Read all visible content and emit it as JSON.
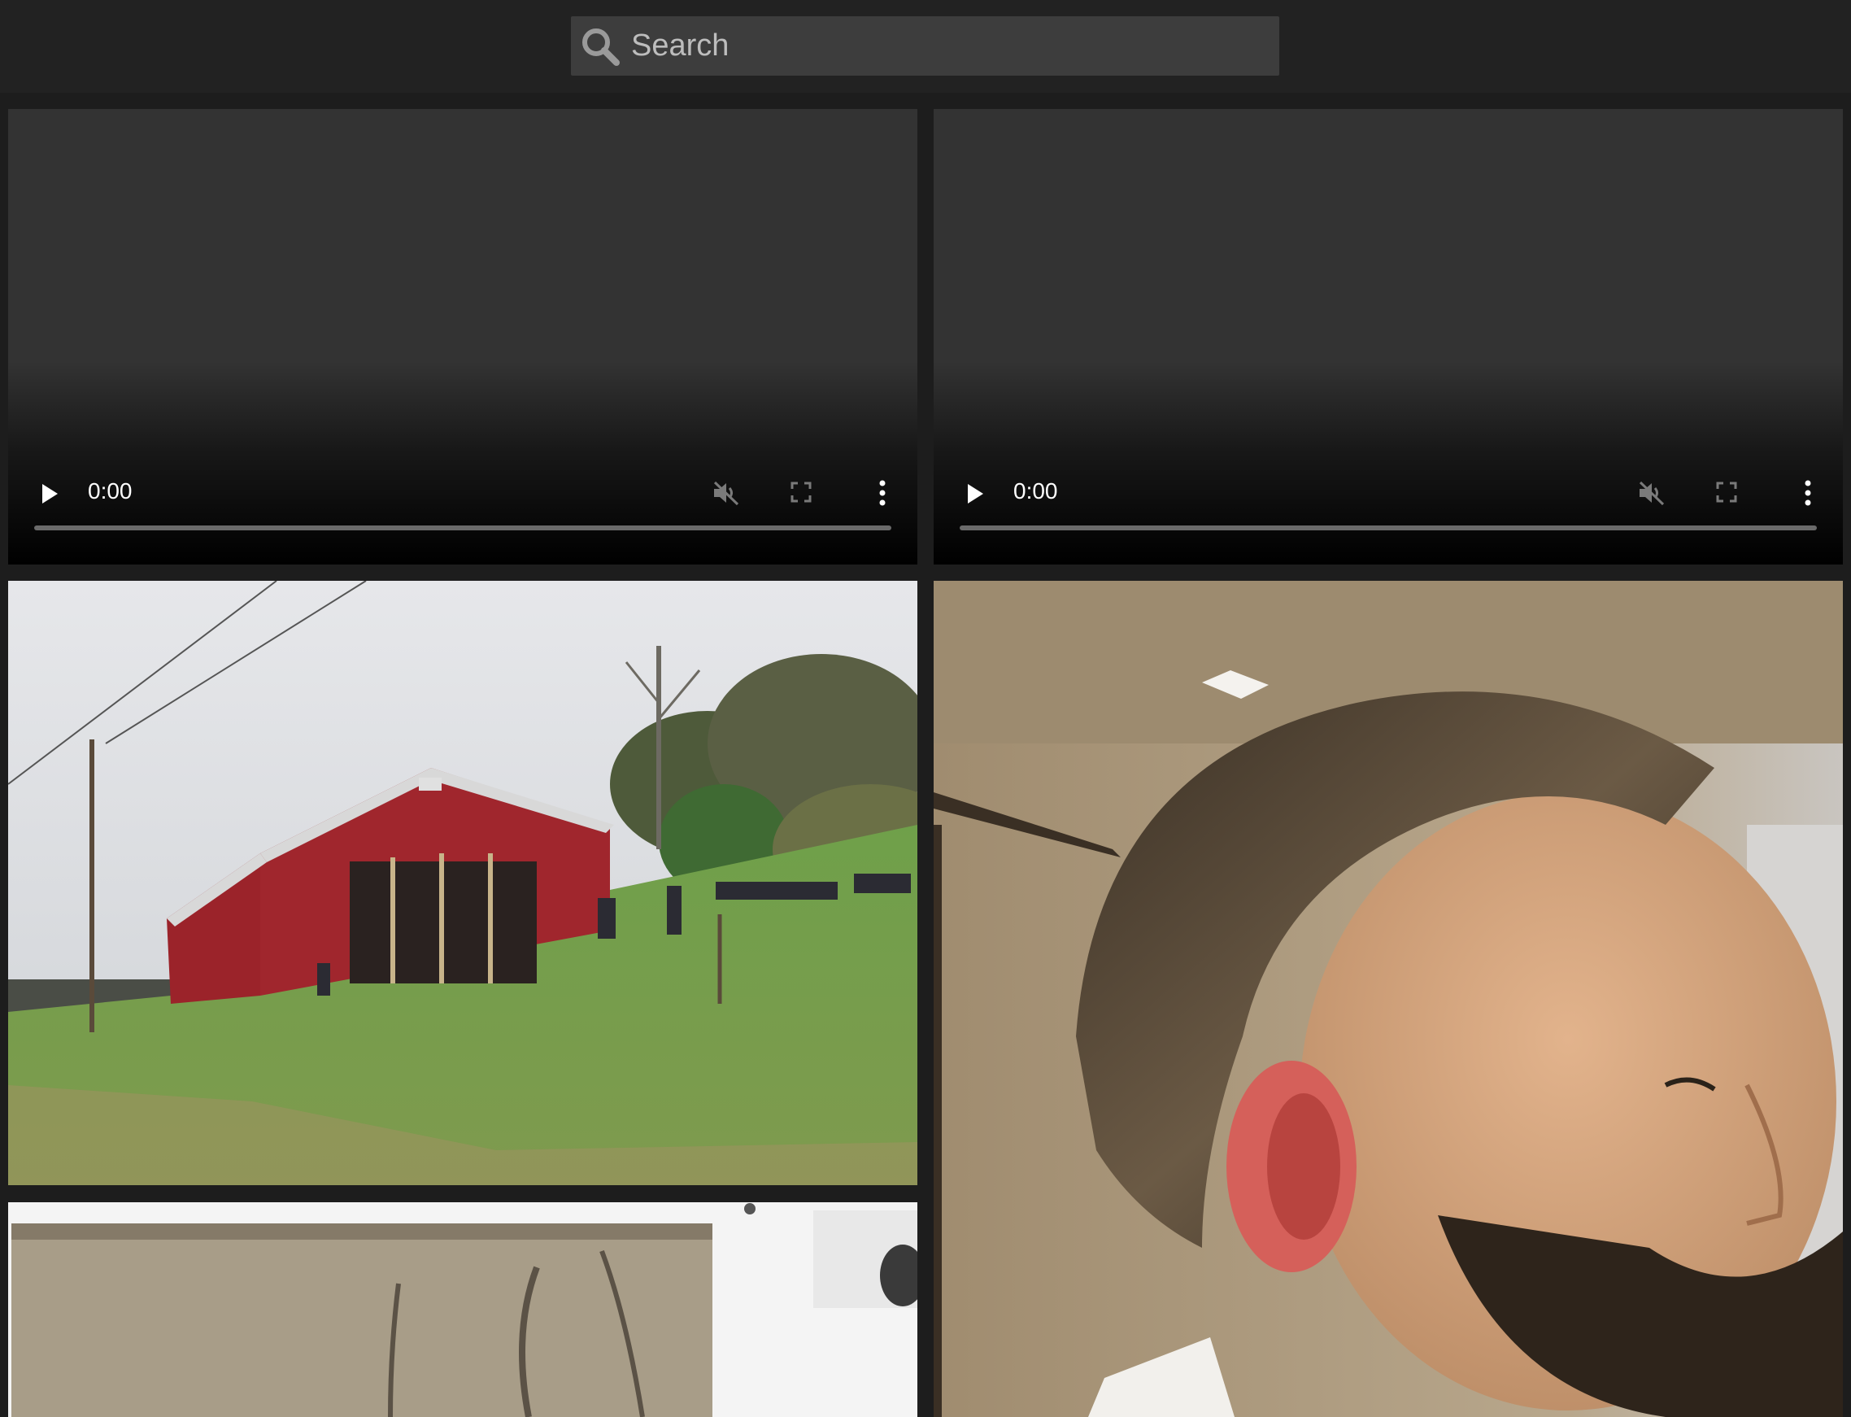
{
  "search": {
    "placeholder": "Search",
    "icon": "search-icon"
  },
  "videos": [
    {
      "time": "0:00"
    },
    {
      "time": "0:00"
    }
  ],
  "colors": {
    "background": "#1d1d1d",
    "topbar": "#222222",
    "search_field": "#3d3d3d",
    "video_bg": "#333333"
  }
}
